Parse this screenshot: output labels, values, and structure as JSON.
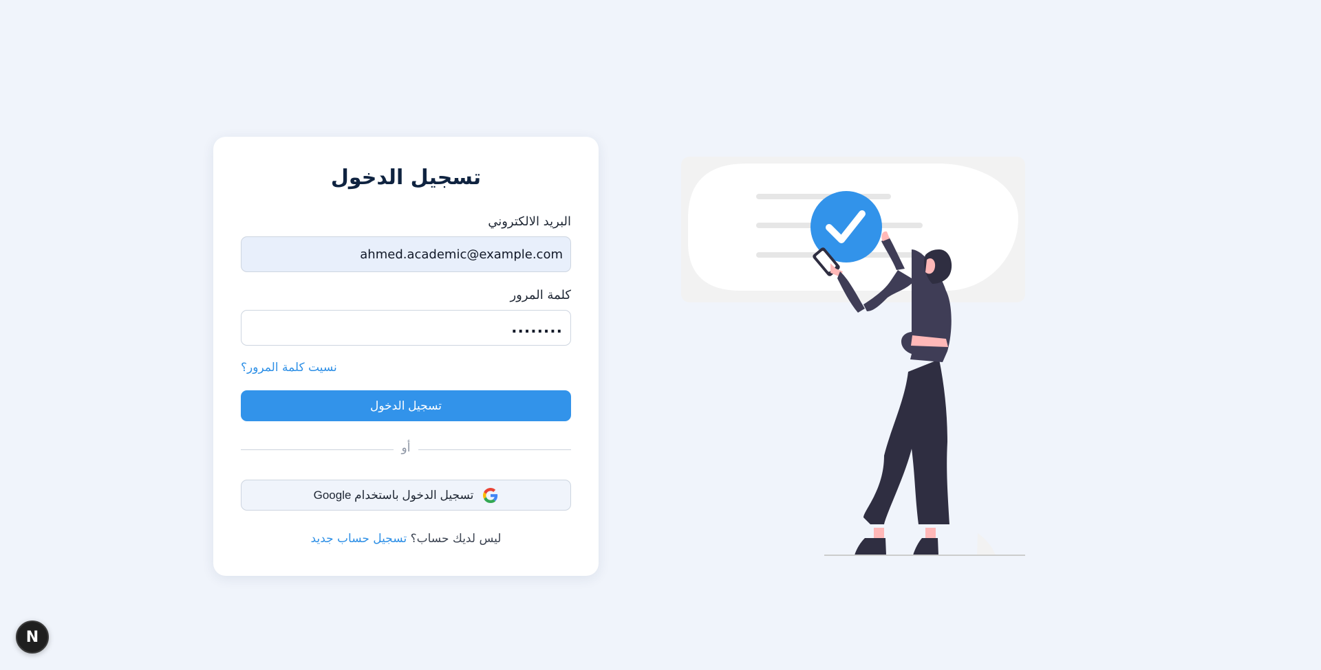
{
  "login": {
    "title": "تسجيل الدخول",
    "email_label": "البريد الالكتروني",
    "email_value": "ahmed.academic@example.com",
    "password_label": "كلمة المرور",
    "password_value": "........",
    "forgot_password": "نسيت كلمة المرور؟",
    "submit_label": "تسجيل الدخول",
    "divider_text": "أو",
    "google_label": "تسجيل الدخول باستخدام Google",
    "no_account_text": "ليس لديك حساب؟",
    "register_link": "تسجيل حساب جديد"
  },
  "illustration": {
    "icon": "checkmark-badge-icon"
  },
  "dev_badge": {
    "letter": "N"
  },
  "colors": {
    "accent": "#3293ea",
    "background": "#f0f4fb",
    "title": "#0f2340",
    "figure_dark": "#2f2e41",
    "figure_skin": "#ffb8b8"
  }
}
